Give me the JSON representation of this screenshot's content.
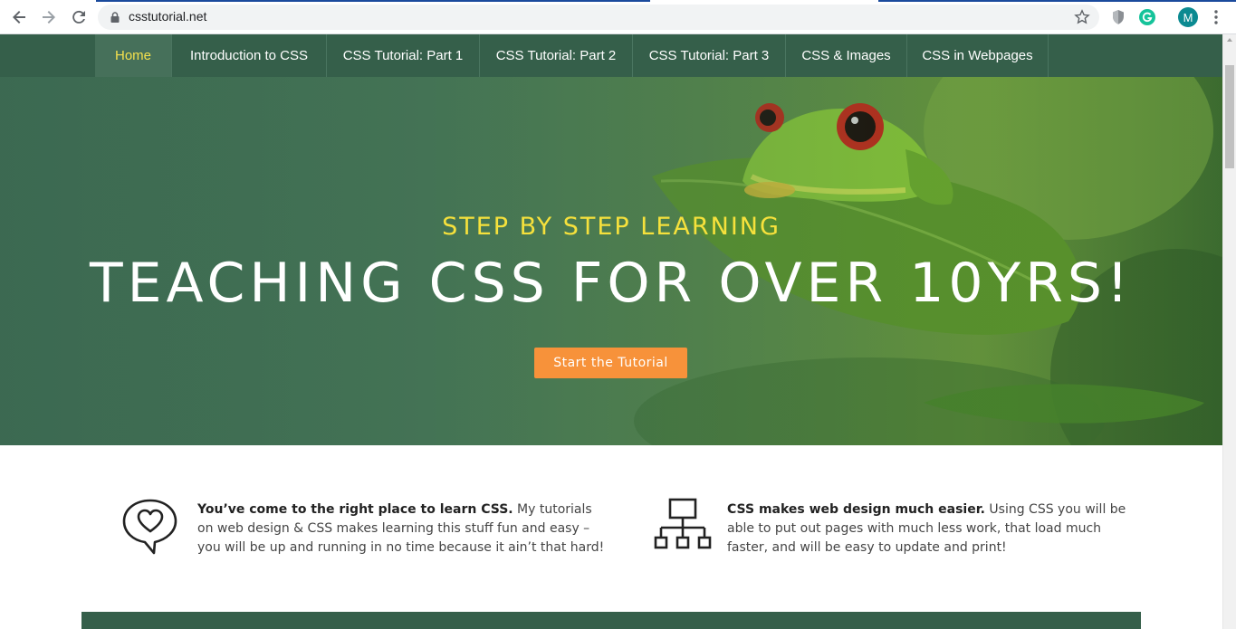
{
  "browser": {
    "url": "csstutorial.net",
    "avatar_letter": "M",
    "icons": [
      "back-arrow-icon",
      "forward-arrow-icon",
      "reload-icon",
      "lock-icon",
      "star-icon",
      "shield-extension-icon",
      "grammarly-extension-icon",
      "kebab-menu-icon"
    ]
  },
  "nav": {
    "items": [
      {
        "label": "Home",
        "active": true
      },
      {
        "label": "Introduction to CSS",
        "active": false
      },
      {
        "label": "CSS Tutorial: Part 1",
        "active": false
      },
      {
        "label": "CSS Tutorial: Part 2",
        "active": false
      },
      {
        "label": "CSS Tutorial: Part 3",
        "active": false
      },
      {
        "label": "CSS & Images",
        "active": false
      },
      {
        "label": "CSS in Webpages",
        "active": false
      }
    ]
  },
  "hero": {
    "kicker": "STEP BY STEP LEARNING",
    "headline": "TEACHING CSS FOR OVER 10YRS!",
    "cta_label": "Start the Tutorial",
    "background": "tree frog on a green leaf"
  },
  "features": [
    {
      "icon": "heart-speech-bubble-icon",
      "bold": "You’ve come to the right place to learn CSS.",
      "text": " My tutorials on web design & CSS makes learning this stuff fun and easy – you will be up and running in no time because it ain’t that hard!"
    },
    {
      "icon": "sitemap-icon",
      "bold": "CSS makes web design much easier.",
      "text": " Using CSS you will be able to put out pages with much less work, that load much faster, and will be easy to update and print!"
    }
  ],
  "colors": {
    "nav_bg": "#355f4a",
    "nav_active_text": "#f4e04d",
    "kicker": "#f6e13c",
    "cta_bg": "#f7923a",
    "avatar_bg": "#0b8a91"
  }
}
